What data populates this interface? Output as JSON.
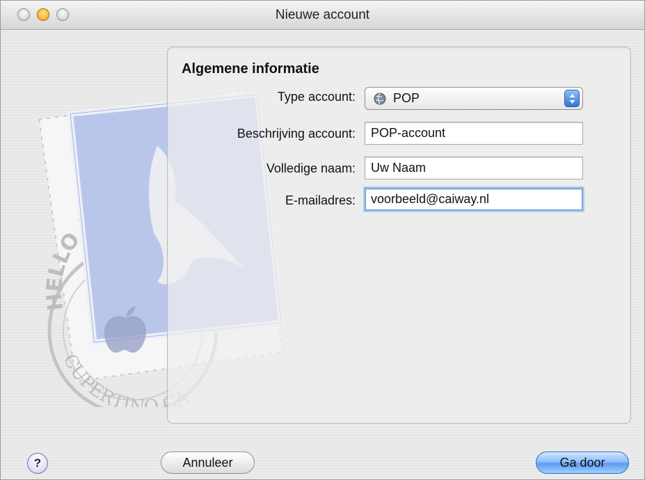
{
  "window": {
    "title": "Nieuwe account"
  },
  "panel": {
    "section_title": "Algemene informatie",
    "fields": [
      {
        "label": "Type account:",
        "value": "POP"
      },
      {
        "label": "Beschrijving account:",
        "value": "POP-account"
      },
      {
        "label": "Volledige naam:",
        "value": "Uw Naam"
      },
      {
        "label": "E-mailadres:",
        "value": "voorbeeld@caiway.nl"
      }
    ]
  },
  "stamp_text": {
    "top": "HELLO FR",
    "bottom": "CUPERTINO CA"
  },
  "buttons": {
    "help": "?",
    "cancel": "Annuleer",
    "continue": "Ga door"
  },
  "icons": {
    "account_type": "globe-icon",
    "popup_arrows": "up-down-arrows-icon",
    "stamp": "mail-stamp-eagle-icon"
  },
  "colors": {
    "focus_ring": "#78a7e3",
    "default_button": "#5b9bf2",
    "minimize_light": "#f3a10d"
  }
}
